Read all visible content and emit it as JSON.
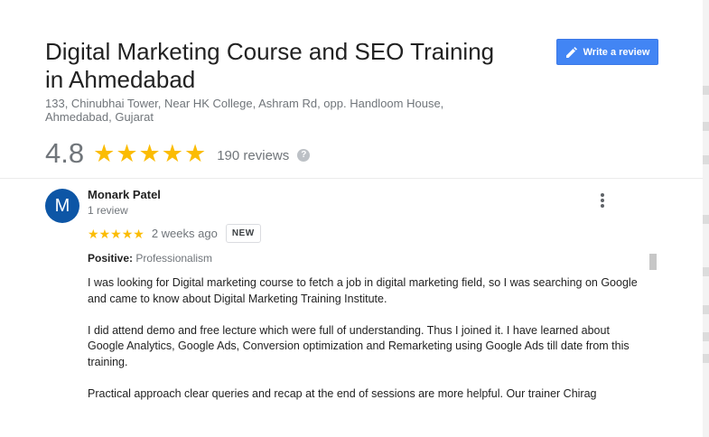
{
  "place": {
    "title": "Digital Marketing Course and SEO Training in Ahmedabad",
    "address": "133, Chinubhai Tower, Near HK College, Ashram Rd, opp. Handloom House, Ahmedabad, Gujarat",
    "rating": "4.8",
    "stars": 5,
    "review_count": "190 reviews",
    "help_glyph": "?"
  },
  "actions": {
    "write_review_label": "Write a review",
    "write_review_icon": "pencil-icon"
  },
  "review": {
    "avatar_letter": "M",
    "avatar_color": "#0d56a6",
    "name": "Monark Patel",
    "sub": "1 review",
    "stars": 5,
    "time": "2 weeks ago",
    "badge": "NEW",
    "positive_label": "Positive:",
    "positive_value": "Professionalism",
    "paragraphs": [
      "I was looking for Digital marketing course to fetch a job in digital marketing field, so I was searching on Google and came to know about Digital Marketing Training Institute.",
      "I did attend demo and free lecture which were full of understanding. Thus I joined it. I have learned about Google Analytics, Google Ads, Conversion optimization and Remarketing using Google Ads till date from this training.",
      "Practical approach clear queries and recap at the end of sessions are more helpful. Our trainer Chirag"
    ]
  },
  "colors": {
    "star": "#fbbc04",
    "accent": "#4285f4",
    "muted_text": "#70757a"
  }
}
